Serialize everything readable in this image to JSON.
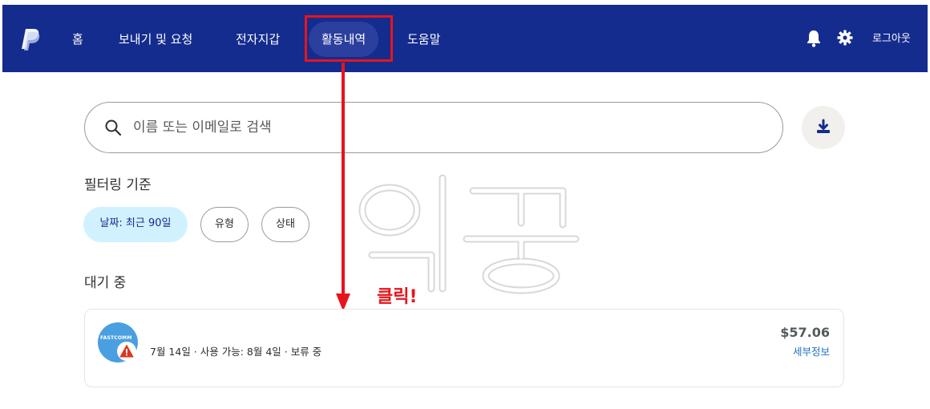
{
  "nav": {
    "items": [
      {
        "label": "홈",
        "active": false
      },
      {
        "label": "보내기 및 요청",
        "active": false
      },
      {
        "label": "전자지갑",
        "active": false
      },
      {
        "label": "활동내역",
        "active": true
      },
      {
        "label": "도움말",
        "active": false
      }
    ],
    "logout_label": "로그아웃",
    "bar_color": "#142c8e"
  },
  "search": {
    "placeholder": "이름 또는 이메일로 검색",
    "value": ""
  },
  "filters": {
    "heading": "필터링 기준",
    "chips": [
      "날짜: 최근 90일",
      "유형",
      "상태"
    ]
  },
  "pending": {
    "heading": "대기 중",
    "transaction": {
      "merchant_logo_text": "FASTCOMM",
      "meta": "7월 14일 · 사용 가능: 8월 4일 · 보류 중",
      "amount": "$57.06",
      "detail_label": "세부정보"
    }
  },
  "annotation": {
    "click_label": "클릭!",
    "color": "#e8141b",
    "watermark_text": "익꿍"
  }
}
